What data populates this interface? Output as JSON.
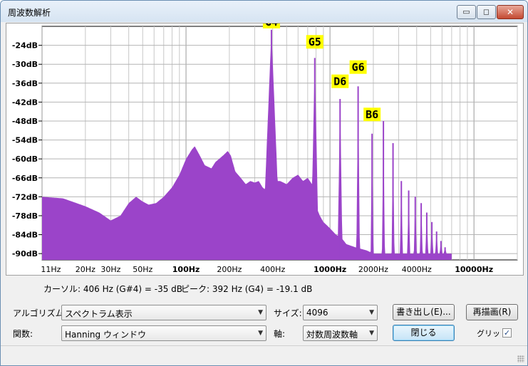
{
  "window": {
    "title": "周波数解析",
    "minimize_glyph": "▭",
    "maximize_glyph": "◻",
    "close_glyph": "✕"
  },
  "chart_data": {
    "type": "area",
    "x_scale": "log",
    "xlim": [
      10,
      20000
    ],
    "ylim": [
      -92,
      -18
    ],
    "grid": true,
    "fill_color": "#9b44c9",
    "y_ticks": [
      {
        "label": "-24dB",
        "v": -24
      },
      {
        "label": "-30dB",
        "v": -30
      },
      {
        "label": "-36dB",
        "v": -36
      },
      {
        "label": "-42dB",
        "v": -42
      },
      {
        "label": "-48dB",
        "v": -48
      },
      {
        "label": "-54dB",
        "v": -54
      },
      {
        "label": "-60dB",
        "v": -60
      },
      {
        "label": "-66dB",
        "v": -66
      },
      {
        "label": "-72dB",
        "v": -72
      },
      {
        "label": "-78dB",
        "v": -78
      },
      {
        "label": "-84dB",
        "v": -84
      },
      {
        "label": "-90dB",
        "v": -90
      }
    ],
    "x_ticks": [
      {
        "label": "11Hz",
        "f": 11,
        "bold": false
      },
      {
        "label": "20Hz",
        "f": 20,
        "bold": false
      },
      {
        "label": "30Hz",
        "f": 30,
        "bold": false
      },
      {
        "label": "50Hz",
        "f": 50,
        "bold": false
      },
      {
        "label": "100Hz",
        "f": 100,
        "bold": true
      },
      {
        "label": "200Hz",
        "f": 200,
        "bold": false
      },
      {
        "label": "400Hz",
        "f": 400,
        "bold": false
      },
      {
        "label": "1000Hz",
        "f": 1000,
        "bold": true
      },
      {
        "label": "2000Hz",
        "f": 2000,
        "bold": false
      },
      {
        "label": "4000Hz",
        "f": 4000,
        "bold": false
      },
      {
        "label": "10000Hz",
        "f": 10000,
        "bold": true
      }
    ],
    "envelope": [
      [
        10,
        -72
      ],
      [
        14,
        -72.5
      ],
      [
        20,
        -75
      ],
      [
        25,
        -77
      ],
      [
        30,
        -79.5
      ],
      [
        35,
        -78
      ],
      [
        40,
        -74
      ],
      [
        45,
        -72
      ],
      [
        50,
        -73.5
      ],
      [
        55,
        -74.5
      ],
      [
        62,
        -74
      ],
      [
        70,
        -72
      ],
      [
        80,
        -69
      ],
      [
        90,
        -65
      ],
      [
        100,
        -60
      ],
      [
        110,
        -57
      ],
      [
        115,
        -56
      ],
      [
        125,
        -59
      ],
      [
        135,
        -62
      ],
      [
        150,
        -63
      ],
      [
        160,
        -61
      ],
      [
        180,
        -59
      ],
      [
        195,
        -57.5
      ],
      [
        205,
        -59
      ],
      [
        220,
        -64
      ],
      [
        240,
        -66
      ],
      [
        260,
        -68
      ],
      [
        280,
        -67
      ],
      [
        300,
        -67.5
      ],
      [
        320,
        -67
      ],
      [
        340,
        -69
      ],
      [
        360,
        -70
      ],
      [
        380,
        -72
      ],
      [
        410,
        -67
      ],
      [
        450,
        -67
      ],
      [
        500,
        -68
      ],
      [
        550,
        -66
      ],
      [
        600,
        -65
      ],
      [
        650,
        -67
      ],
      [
        700,
        -66
      ],
      [
        750,
        -68
      ],
      [
        800,
        -75
      ],
      [
        850,
        -78
      ],
      [
        900,
        -80
      ],
      [
        950,
        -81
      ],
      [
        1000,
        -82
      ],
      [
        1100,
        -84
      ],
      [
        1200,
        -85
      ],
      [
        1300,
        -87
      ],
      [
        1500,
        -88
      ],
      [
        1800,
        -89
      ],
      [
        2000,
        -90
      ],
      [
        20000,
        -90
      ]
    ],
    "peaks": [
      {
        "f": 392,
        "db": -19.1,
        "w": 0.045
      },
      {
        "f": 784,
        "db": -28,
        "w": 0.02
      },
      {
        "f": 1175,
        "db": -41,
        "w": 0.015
      },
      {
        "f": 1568,
        "db": -37,
        "w": 0.012
      },
      {
        "f": 1960,
        "db": -52,
        "w": 0.01
      },
      {
        "f": 2350,
        "db": -48,
        "w": 0.01
      },
      {
        "f": 2740,
        "db": -55,
        "w": 0.01
      },
      {
        "f": 3130,
        "db": -67,
        "w": 0.01
      },
      {
        "f": 3520,
        "db": -70,
        "w": 0.01
      },
      {
        "f": 3910,
        "db": -72,
        "w": 0.01
      },
      {
        "f": 4300,
        "db": -74,
        "w": 0.01
      },
      {
        "f": 4700,
        "db": -77,
        "w": 0.01
      },
      {
        "f": 5100,
        "db": -80,
        "w": 0.01
      },
      {
        "f": 5500,
        "db": -83,
        "w": 0.01
      },
      {
        "f": 5900,
        "db": -86,
        "w": 0.01
      },
      {
        "f": 6300,
        "db": -88,
        "w": 0.01
      }
    ],
    "note_labels": [
      {
        "text": "G4",
        "f": 392,
        "db": -19.1
      },
      {
        "text": "G5",
        "f": 784,
        "db": -25.5
      },
      {
        "text": "D6",
        "f": 1175,
        "db": -38
      },
      {
        "text": "G6",
        "f": 1568,
        "db": -33.5
      },
      {
        "text": "B6",
        "f": 1960,
        "db": -48.5
      }
    ]
  },
  "info": {
    "cursor": "カーソル: 406 Hz (G#4) = -35 dB",
    "peak": "ピーク: 392 Hz (G4) = -19.1 dB"
  },
  "controls": {
    "algorithm_label": "アルゴリズム:",
    "algorithm_value": "スペクトラム表示",
    "function_label": "関数:",
    "function_value": "Hanning ウィンドウ",
    "size_label": "サイズ:",
    "size_value": "4096",
    "axis_label": "軸:",
    "axis_value": "対数周波数軸",
    "export_button": "書き出し(E)...",
    "replot_button": "再描画(R)",
    "close_button": "閉じる",
    "grid_label": "グリッド",
    "grid_checked": "✓"
  }
}
